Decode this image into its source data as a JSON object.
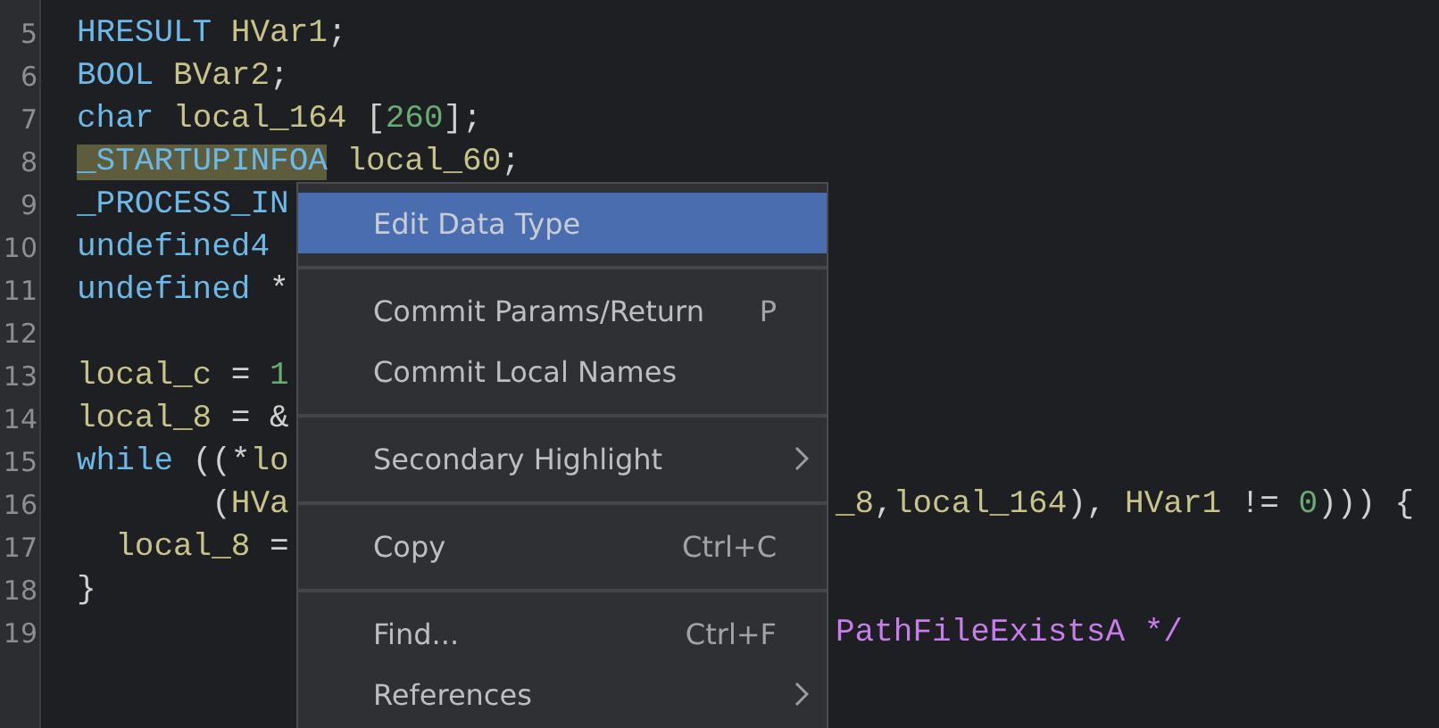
{
  "code_lines": [
    {
      "number": "5",
      "tokens": [
        {
          "kind": "type",
          "text": "HRESULT"
        },
        {
          "kind": "var",
          "text": " HVar1"
        },
        {
          "kind": "punct",
          "text": ";"
        }
      ]
    },
    {
      "number": "6",
      "tokens": [
        {
          "kind": "type",
          "text": "BOOL"
        },
        {
          "kind": "var",
          "text": " BVar2"
        },
        {
          "kind": "punct",
          "text": ";"
        }
      ]
    },
    {
      "number": "7",
      "tokens": [
        {
          "kind": "type",
          "text": "char"
        },
        {
          "kind": "var",
          "text": " local_164"
        },
        {
          "kind": "punct",
          "text": " ["
        },
        {
          "kind": "num",
          "text": "260"
        },
        {
          "kind": "punct",
          "text": "];"
        }
      ]
    },
    {
      "number": "8",
      "tokens": [
        {
          "kind": "type",
          "text": "_STARTUPINFOA",
          "highlighted": true
        },
        {
          "kind": "var",
          "text": " local_60"
        },
        {
          "kind": "punct",
          "text": ";"
        }
      ]
    },
    {
      "number": "9",
      "tokens": [
        {
          "kind": "type",
          "text": "_PROCESS_IN"
        }
      ]
    },
    {
      "number": "10",
      "tokens": [
        {
          "kind": "type",
          "text": "undefined4"
        }
      ]
    },
    {
      "number": "11",
      "tokens": [
        {
          "kind": "type",
          "text": "undefined"
        },
        {
          "kind": "punct",
          "text": " *"
        }
      ]
    },
    {
      "number": "12"
    },
    {
      "number": "13",
      "tokens": [
        {
          "kind": "var",
          "text": "local_c"
        },
        {
          "kind": "punct",
          "text": " = "
        },
        {
          "kind": "num",
          "text": "1"
        }
      ]
    },
    {
      "number": "14",
      "tokens": [
        {
          "kind": "var",
          "text": "local_8"
        },
        {
          "kind": "punct",
          "text": " = &"
        }
      ]
    },
    {
      "number": "15",
      "tokens": [
        {
          "kind": "keyword",
          "text": "while"
        },
        {
          "kind": "punct",
          "text": " ((*"
        },
        {
          "kind": "var",
          "text": "lo"
        }
      ]
    },
    {
      "number": "16",
      "tokens": [
        {
          "kind": "punct",
          "text": "       ("
        },
        {
          "kind": "var",
          "text": "HVa"
        }
      ],
      "right_tokens": [
        {
          "kind": "var",
          "text": "_8"
        },
        {
          "kind": "punct",
          "text": ","
        },
        {
          "kind": "var",
          "text": "local_164"
        },
        {
          "kind": "punct",
          "text": "), "
        },
        {
          "kind": "var",
          "text": "HVar1"
        },
        {
          "kind": "punct",
          "text": " != "
        },
        {
          "kind": "num",
          "text": "0"
        },
        {
          "kind": "punct",
          "text": "))) {"
        }
      ]
    },
    {
      "number": "17",
      "tokens": [
        {
          "kind": "var",
          "text": "  local_8"
        },
        {
          "kind": "punct",
          "text": " ="
        }
      ]
    },
    {
      "number": "18",
      "tokens": [
        {
          "kind": "punct",
          "text": "}"
        }
      ]
    },
    {
      "number": "19",
      "right_tokens": [
        {
          "kind": "comment",
          "text": "PathFileExistsA */"
        }
      ]
    }
  ],
  "context_menu": [
    {
      "kind": "item",
      "label": "Edit Data Type",
      "selected": true,
      "submenu": false
    },
    {
      "kind": "separator"
    },
    {
      "kind": "item",
      "label": "Commit Params/Return",
      "shortcut": "P",
      "selected": false,
      "submenu": false
    },
    {
      "kind": "item",
      "label": "Commit Local Names",
      "selected": false,
      "submenu": false
    },
    {
      "kind": "separator"
    },
    {
      "kind": "item",
      "label": "Secondary Highlight",
      "selected": false,
      "submenu": true
    },
    {
      "kind": "separator"
    },
    {
      "kind": "item",
      "label": "Copy",
      "shortcut": "Ctrl+C",
      "selected": false,
      "submenu": false
    },
    {
      "kind": "separator"
    },
    {
      "kind": "item",
      "label": "Find...",
      "shortcut": "Ctrl+F",
      "selected": false,
      "submenu": false
    },
    {
      "kind": "item",
      "label": "References",
      "selected": false,
      "submenu": true
    }
  ]
}
